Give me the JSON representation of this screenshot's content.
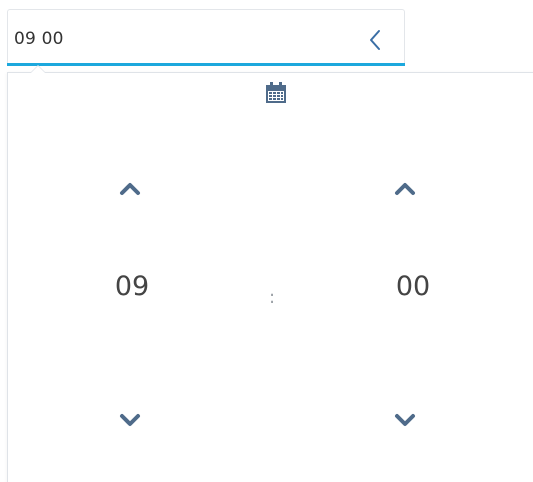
{
  "input": {
    "value": "09 00"
  },
  "picker": {
    "hours": "09",
    "minutes": "00",
    "separator": ":"
  },
  "icons": {
    "toggle": "chevron-left-icon",
    "calendar": "calendar-icon",
    "increment": "chevron-up-icon",
    "decrement": "chevron-down-icon"
  },
  "colors": {
    "accent": "#1ca8dd",
    "icon": "#4f6b8a",
    "text": "#444444"
  }
}
